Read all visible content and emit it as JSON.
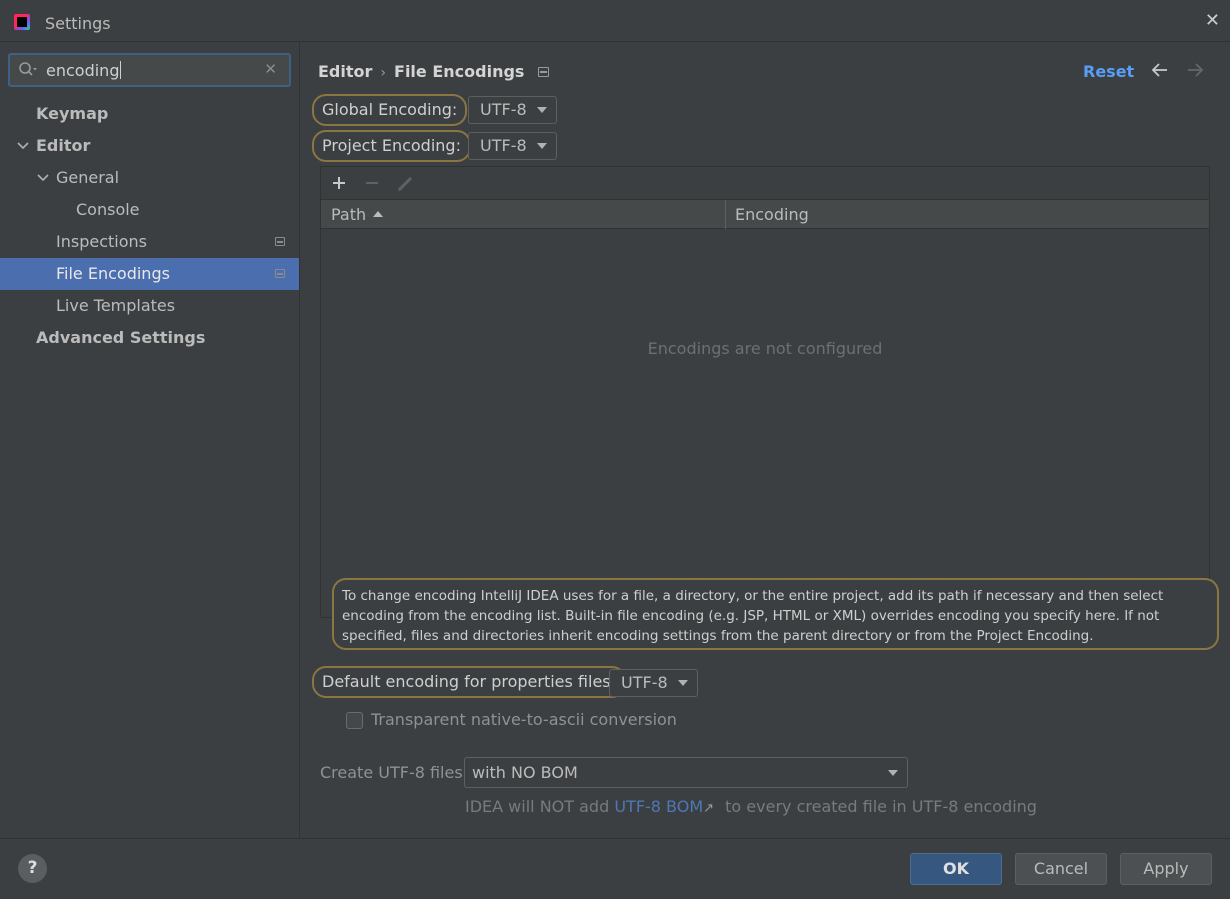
{
  "window": {
    "title": "Settings"
  },
  "search": {
    "value": "encoding"
  },
  "tree": {
    "items": [
      {
        "label": "Keymap"
      },
      {
        "label": "Editor"
      },
      {
        "label": "General"
      },
      {
        "label": "Console"
      },
      {
        "label": "Inspections"
      },
      {
        "label": "File Encodings"
      },
      {
        "label": "Live Templates"
      },
      {
        "label": "Advanced Settings"
      }
    ],
    "selected": "File Encodings"
  },
  "header": {
    "breadcrumb_parent": "Editor",
    "breadcrumb_current": "File Encodings",
    "reset_label": "Reset"
  },
  "global_encoding": {
    "label": "Global Encoding:",
    "value": "UTF-8"
  },
  "project_encoding": {
    "label": "Project Encoding:",
    "value": "UTF-8"
  },
  "table": {
    "columns": [
      "Path",
      "Encoding"
    ],
    "empty_text": "Encodings are not configured"
  },
  "info_text": "To change encoding IntelliJ IDEA uses for a file, a directory, or the entire project, add its path if necessary and then select encoding from the encoding list. Built-in file encoding (e.g. JSP, HTML or XML) overrides encoding you specify here. If not specified, files and directories inherit encoding settings from the parent directory or from the Project Encoding.",
  "properties_encoding": {
    "label": "Default encoding for properties files:",
    "value": "UTF-8"
  },
  "transparent_ascii": {
    "label": "Transparent native-to-ascii conversion",
    "checked": false
  },
  "utf8_files": {
    "label": "Create UTF-8 files:",
    "value": "with NO BOM",
    "hint_prefix": "IDEA will NOT add",
    "hint_link": "UTF-8 BOM",
    "hint_suffix": "to every created file in UTF-8 encoding"
  },
  "footer": {
    "help_label": "?",
    "ok_label": "OK",
    "cancel_label": "Cancel",
    "apply_label": "Apply"
  },
  "colors": {
    "background": "#3c3f41",
    "selection": "#4b6eaf",
    "link": "#589df6",
    "search_highlight": "#8a7543",
    "primary_button": "#365880"
  }
}
